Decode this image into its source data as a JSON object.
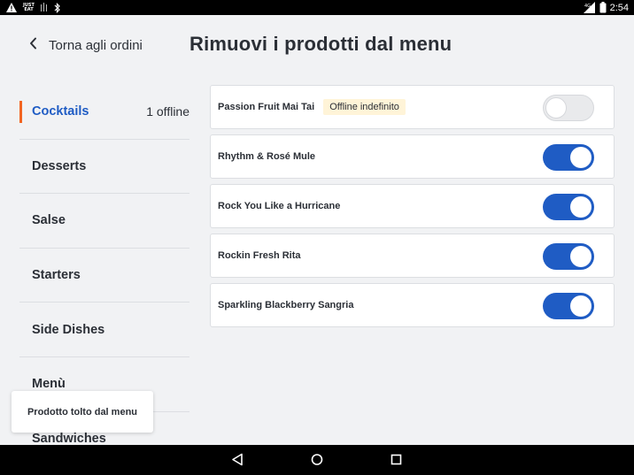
{
  "status_bar": {
    "carrier_top": "JUST",
    "carrier_bottom": "EAT",
    "network": "4G",
    "time": "2:54",
    "icons": [
      "warning-icon",
      "just-eat-icon",
      "signal-bars-icon",
      "bluetooth-icon",
      "lte-icon",
      "battery-icon"
    ]
  },
  "header": {
    "back_label": "Torna agli ordini",
    "back_icon": "chevron-left-icon",
    "title": "Rimuovi i prodotti dal menu"
  },
  "sidebar": {
    "items": [
      {
        "label": "Cocktails",
        "count": "1 offline",
        "active": true
      },
      {
        "label": "Desserts",
        "count": ""
      },
      {
        "label": "Salse",
        "count": ""
      },
      {
        "label": "Starters",
        "count": ""
      },
      {
        "label": "Side Dishes",
        "count": ""
      },
      {
        "label": "Menù",
        "count": ""
      },
      {
        "label": "Sandwiches",
        "count": ""
      }
    ]
  },
  "products": [
    {
      "name": "Passion Fruit Mai Tai",
      "badge": "Offline indefinito",
      "enabled": false
    },
    {
      "name": "Rhythm & Rosé Mule",
      "badge": "",
      "enabled": true
    },
    {
      "name": "Rock You Like a Hurricane",
      "badge": "",
      "enabled": true
    },
    {
      "name": "Rockin Fresh Rita",
      "badge": "",
      "enabled": true
    },
    {
      "name": "Sparkling Blackberry Sangria",
      "badge": "",
      "enabled": true
    }
  ],
  "toast": {
    "message": "Prodotto tolto dal menu"
  },
  "nav_bar": {
    "icons": [
      "back-triangle-icon",
      "home-circle-icon",
      "recents-square-icon"
    ]
  },
  "colors": {
    "accent": "#1f5cc4",
    "active_marker": "#f26522",
    "badge_bg": "#fff4d8"
  }
}
